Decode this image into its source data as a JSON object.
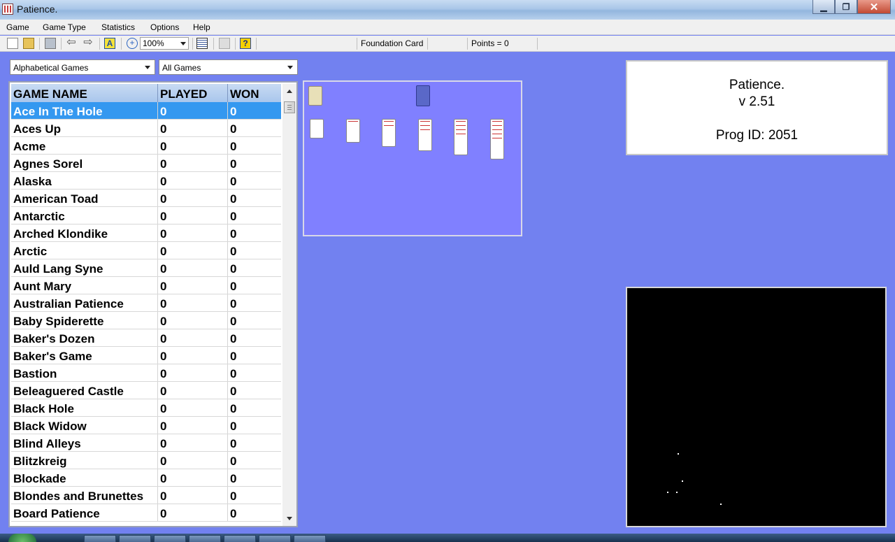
{
  "window": {
    "title": "Patience.",
    "controls": [
      "minimize-icon",
      "maximize-icon",
      "close-icon"
    ],
    "close_symbol": "✕"
  },
  "menu": [
    "Game",
    "Game Type",
    "Statistics",
    "Options",
    "Help"
  ],
  "toolbar": {
    "zoom": "100%",
    "font_button": "A",
    "help_button": "?",
    "zoom_button": "+",
    "status_foundation": "Foundation Card",
    "status_points": "Points = 0",
    "back_glyph": "⇦",
    "forward_glyph": "⇨"
  },
  "filters": {
    "sort": "Alphabetical Games",
    "category": "All Games"
  },
  "gamelist": {
    "headers": [
      "GAME NAME",
      "PLAYED",
      "WON"
    ],
    "selected_index": 0,
    "rows": [
      [
        "Ace In The Hole",
        "0",
        "0"
      ],
      [
        "Aces Up",
        "0",
        "0"
      ],
      [
        "Acme",
        "0",
        "0"
      ],
      [
        "Agnes Sorel",
        "0",
        "0"
      ],
      [
        "Alaska",
        "0",
        "0"
      ],
      [
        "American Toad",
        "0",
        "0"
      ],
      [
        "Antarctic",
        "0",
        "0"
      ],
      [
        "Arched Klondike",
        "0",
        "0"
      ],
      [
        "Arctic",
        "0",
        "0"
      ],
      [
        "Auld Lang Syne",
        "0",
        "0"
      ],
      [
        "Aunt Mary",
        "0",
        "0"
      ],
      [
        "Australian Patience",
        "0",
        "0"
      ],
      [
        "Baby Spiderette",
        "0",
        "0"
      ],
      [
        "Baker's Dozen",
        "0",
        "0"
      ],
      [
        "Baker's Game",
        "0",
        "0"
      ],
      [
        "Bastion",
        "0",
        "0"
      ],
      [
        "Beleaguered Castle",
        "0",
        "0"
      ],
      [
        "Black Hole",
        "0",
        "0"
      ],
      [
        "Black Widow",
        "0",
        "0"
      ],
      [
        "Blind Alleys",
        "0",
        "0"
      ],
      [
        "Blitzkreig",
        "0",
        "0"
      ],
      [
        "Blockade",
        "0",
        "0"
      ],
      [
        "Blondes and Brunettes",
        "0",
        "0"
      ],
      [
        "Board Patience",
        "0",
        "0"
      ]
    ]
  },
  "info": {
    "app": "Patience.",
    "version": "v 2.51",
    "prog_id": "Prog ID: 2051"
  },
  "colors": {
    "background": "#7281f0",
    "selection": "#3498f0",
    "preview_felt": "#8080ff"
  }
}
